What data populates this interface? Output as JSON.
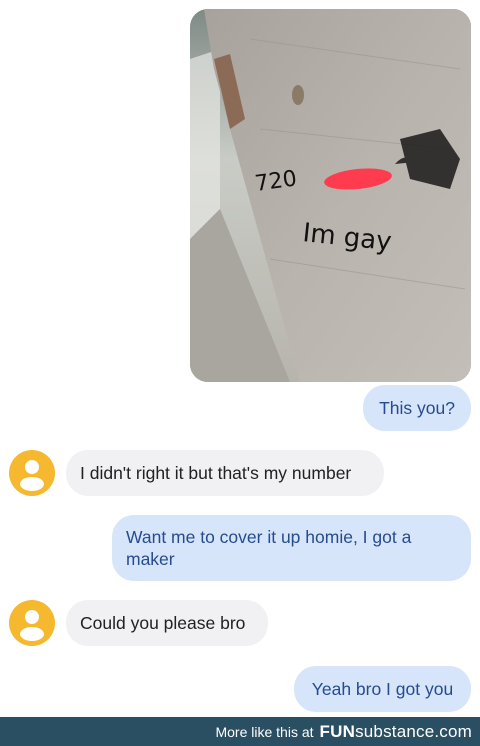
{
  "photo": {
    "scrawl_number": "720",
    "scrawl_text": "Im gay"
  },
  "messages": [
    {
      "text": "This you?",
      "direction": "outgoing"
    },
    {
      "text": "I didn't right it but that's my number",
      "direction": "incoming"
    },
    {
      "text": "Want me to cover it up homie, I got a maker",
      "direction": "outgoing"
    },
    {
      "text": "Could you please bro",
      "direction": "incoming"
    },
    {
      "text": "Yeah bro I got you",
      "direction": "outgoing"
    }
  ],
  "avatar_icon": "person-icon",
  "footer": {
    "text": "More like this at",
    "brand_bold": "FUN",
    "brand_rest": "substance.com"
  },
  "colors": {
    "outgoing_bubble": "#d7e5fa",
    "outgoing_text": "#264c8f",
    "incoming_bubble": "#f1f1f3",
    "avatar": "#f5b82e",
    "footer_bg": "#2a4f63"
  }
}
